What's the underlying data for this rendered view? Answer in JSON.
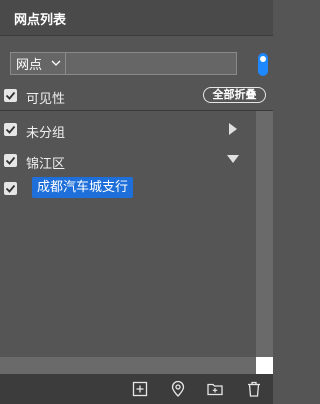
{
  "panel": {
    "title": "网点列表"
  },
  "filter": {
    "type_selected": "网点",
    "search_value": "",
    "search_placeholder": ""
  },
  "visibility": {
    "label": "可见性",
    "checked": true,
    "collapse_all_label": "全部折叠"
  },
  "tree": {
    "items": [
      {
        "label": "未分组",
        "checked": true,
        "expanded": false
      },
      {
        "label": "锦江区",
        "checked": true,
        "expanded": true
      },
      {
        "label": "成都汽车城支行",
        "checked": true,
        "selected": true
      }
    ]
  },
  "footer": {
    "icons": [
      "add-icon",
      "location-pin-icon",
      "add-folder-icon",
      "delete-icon"
    ]
  },
  "colors": {
    "accent": "#1e6fd9",
    "toggle": "#1e88ff",
    "background": "#555555"
  }
}
